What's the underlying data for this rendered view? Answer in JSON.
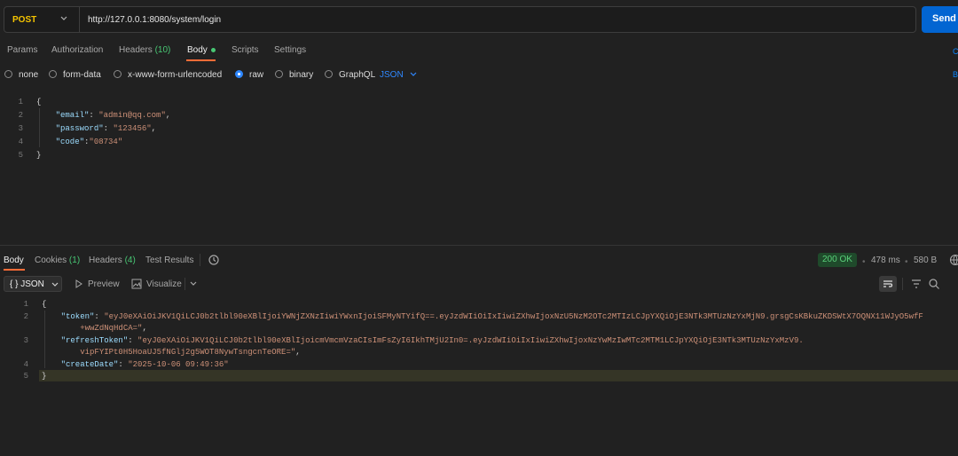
{
  "request": {
    "method": "POST",
    "url": "http://127.0.0.1:8080/system/login",
    "send_label": "Send",
    "tabs": [
      {
        "label": "Params"
      },
      {
        "label": "Authorization"
      },
      {
        "label": "Headers",
        "count": "(10)"
      },
      {
        "label": "Body"
      },
      {
        "label": "Scripts"
      },
      {
        "label": "Settings"
      }
    ],
    "right_cut_1": "C",
    "right_cut_2": "B",
    "body_types": [
      "none",
      "form-data",
      "x-www-form-urlencoded",
      "raw",
      "binary",
      "GraphQL"
    ],
    "body_type_selected": "raw",
    "format": "JSON"
  },
  "request_body": {
    "lines": [
      "1",
      "2",
      "3",
      "4",
      "5"
    ],
    "open": "{",
    "email_key": "\"email\"",
    "email_val": "\"admin@qq.com\"",
    "password_key": "\"password\"",
    "password_val": "\"123456\"",
    "code_key": "\"code\"",
    "code_val": "\"08734\"",
    "close": "}"
  },
  "response": {
    "tabs": [
      {
        "label": "Body"
      },
      {
        "label": "Cookies",
        "count": "(1)"
      },
      {
        "label": "Headers",
        "count": "(4)"
      },
      {
        "label": "Test Results"
      }
    ],
    "status": "200 OK",
    "time": "478 ms",
    "size": "580 B",
    "view_format": "{ } JSON",
    "preview_label": "Preview",
    "visualize_label": "Visualize",
    "lines": [
      "1",
      "2",
      "3",
      "4",
      "5"
    ],
    "open": "{",
    "token_key": "\"token\"",
    "token_val_1": "\"eyJ0eXAiOiJKV1QiLCJ0b2tlbl90eXBlIjoiYWNjZXNzIiwiYWxnIjoiSFMyNTYifQ==.eyJzdWIiOiIxIiwiZXhwIjoxNzU5NzM2OTc2MTIzLCJpYXQiOjE3NTk3MTUzNzYxMjN9.grsgCsKBkuZKDSWtX7OQNX11WJyO5wfF",
    "token_val_2": "+wwZdNqHdCA=\"",
    "refresh_key": "\"refreshToken\"",
    "refresh_val_1": "\"eyJ0eXAiOiJKV1QiLCJ0b2tlbl90eXBlIjoicmVmcmVzaCIsImFsZyI6IkhTMjU2In0=.eyJzdWIiOiIxIiwiZXhwIjoxNzYwMzIwMTc2MTM1LCJpYXQiOjE3NTk3MTUzNzYxMzV9.",
    "refresh_val_2": "vipFYIPt0H5HoaUJ5fNGlj2g5WOT8NywTsngcnTeORE=\"",
    "date_key": "\"createDate\"",
    "date_val": "\"2025-10-06 09:49:36\"",
    "close": "}"
  },
  "colors": {
    "method": "#f5c400",
    "send": "#0265d2",
    "accent_tab": "#ff6c37",
    "status_ok": "#5ad07a",
    "json_key": "#9cdcfe",
    "json_string": "#ce9178"
  }
}
